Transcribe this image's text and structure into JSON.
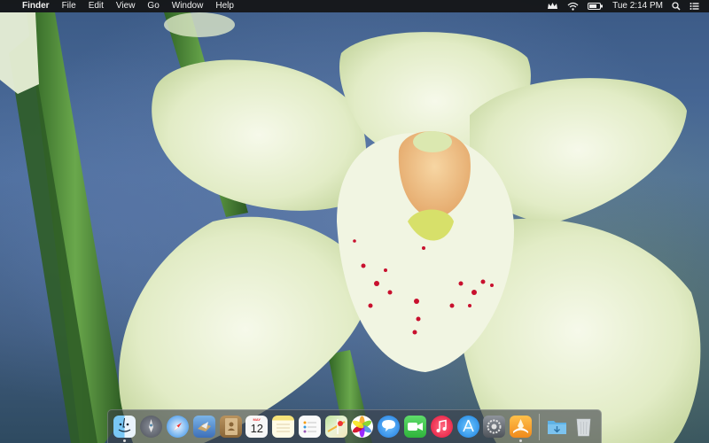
{
  "menubar": {
    "apple_glyph": "",
    "app_name": "Finder",
    "menus": [
      "File",
      "Edit",
      "View",
      "Go",
      "Window",
      "Help"
    ],
    "clock": "Tue 2:14 PM"
  },
  "dock": {
    "calendar_month": "MAY",
    "calendar_day": "12",
    "apps": [
      "finder-icon",
      "launchpad-icon",
      "safari-icon",
      "mail-icon",
      "contacts-icon",
      "calendar-icon",
      "notes-icon",
      "reminders-icon",
      "maps-icon",
      "photos-icon",
      "messages-icon",
      "facetime-icon",
      "itunes-icon",
      "app-store-icon",
      "system-preferences-icon",
      "ibooks-icon",
      "downloads-folder-icon",
      "trash-icon"
    ]
  },
  "colors": {
    "menubar_bg": "#1a1a1a",
    "dock_bg": "#3c4048",
    "petal": "#eef4dc",
    "stem": "#4e8a38",
    "lip_spot": "#c8102e"
  }
}
